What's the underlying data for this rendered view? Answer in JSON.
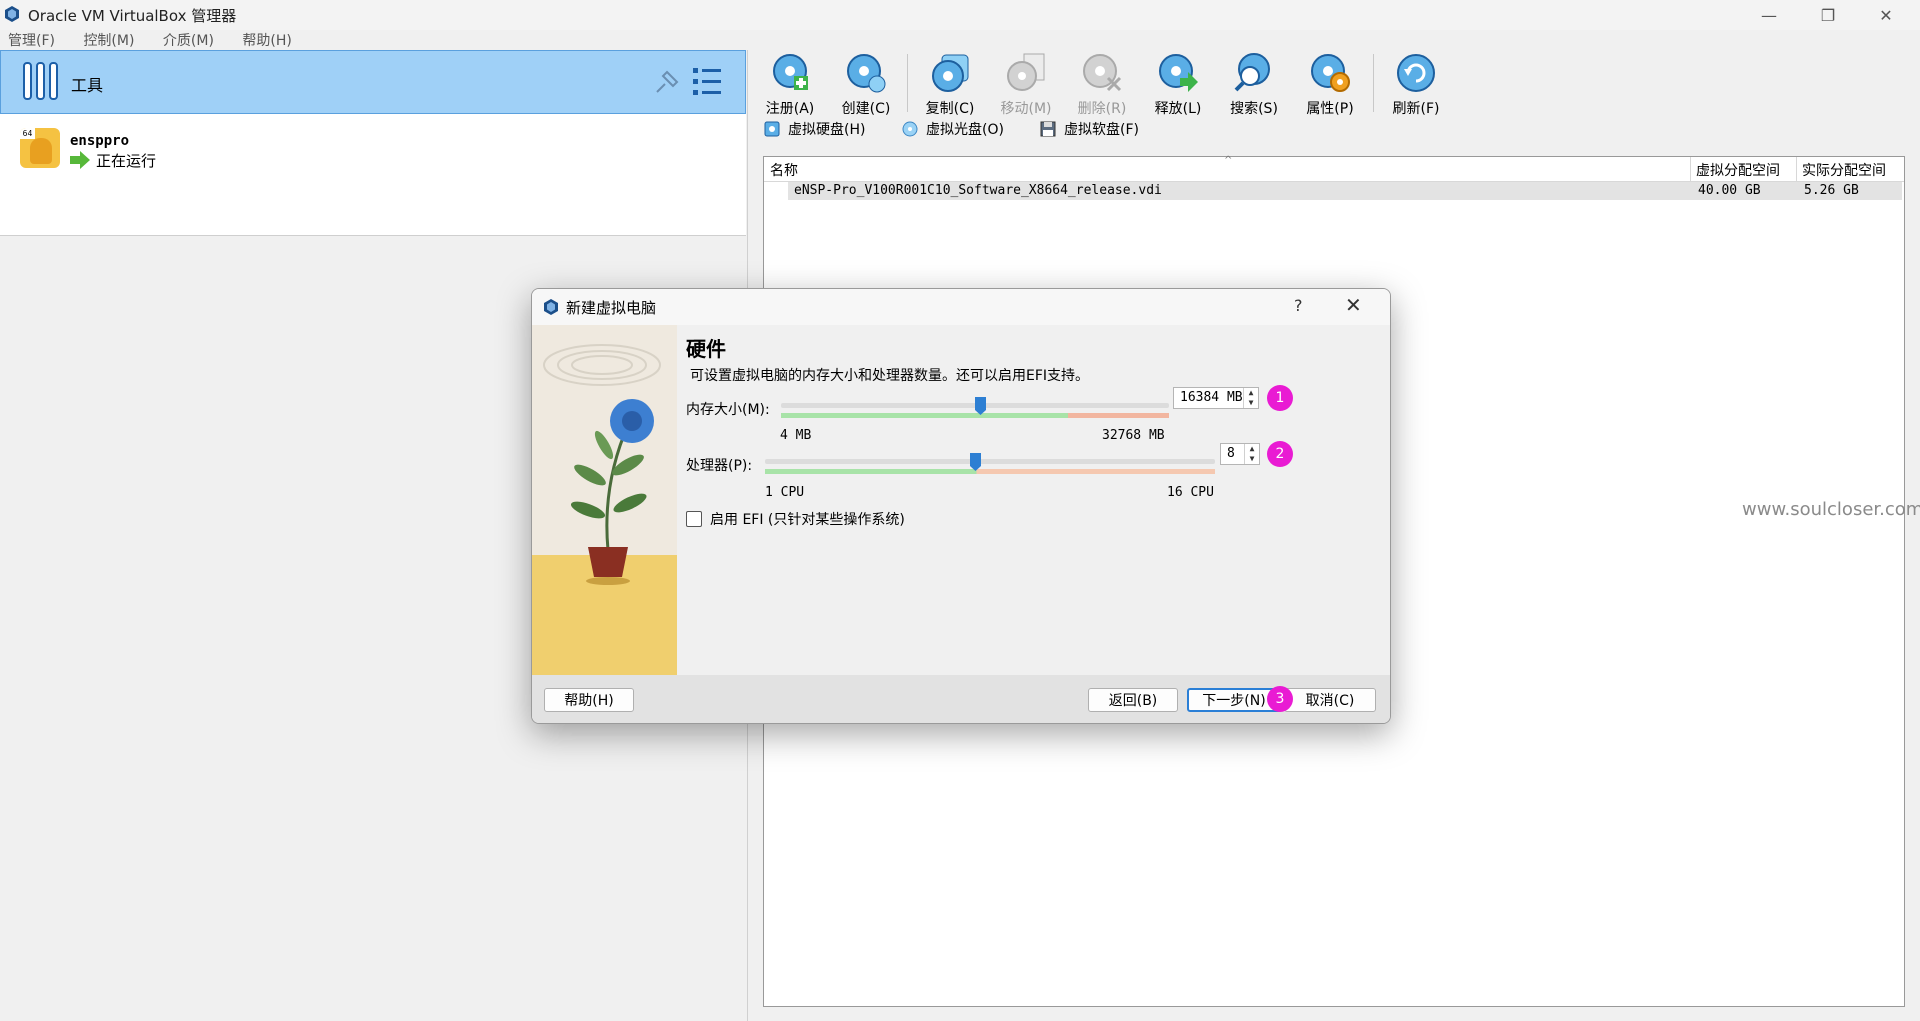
{
  "window": {
    "title": "Oracle VM VirtualBox 管理器",
    "controls": {
      "minimize": "—",
      "restore": "❐",
      "close": "✕"
    }
  },
  "menu": [
    "管理(F)",
    "控制(M)",
    "介质(M)",
    "帮助(H)"
  ],
  "left_panel": {
    "tools_label": "工具",
    "vm": {
      "name": "ensppro",
      "status": "正在运行",
      "badge": "64"
    }
  },
  "toolbar": {
    "buttons": [
      {
        "label": "注册(A)",
        "icon": "register-disk-icon",
        "enabled": true
      },
      {
        "label": "创建(C)",
        "icon": "create-disk-icon",
        "enabled": true
      },
      {
        "label": "复制(C)",
        "icon": "copy-disk-icon",
        "enabled": true
      },
      {
        "label": "移动(M)",
        "icon": "move-disk-icon",
        "enabled": false
      },
      {
        "label": "删除(R)",
        "icon": "delete-disk-icon",
        "enabled": false
      },
      {
        "label": "释放(L)",
        "icon": "release-disk-icon",
        "enabled": true
      },
      {
        "label": "搜索(S)",
        "icon": "search-disk-icon",
        "enabled": true
      },
      {
        "label": "属性(P)",
        "icon": "properties-disk-icon",
        "enabled": true
      },
      {
        "label": "刷新(F)",
        "icon": "refresh-icon",
        "enabled": true
      }
    ]
  },
  "tabs": [
    {
      "label": "虚拟硬盘(H)",
      "icon": "hard-disk-icon"
    },
    {
      "label": "虚拟光盘(O)",
      "icon": "optical-disk-icon"
    },
    {
      "label": "虚拟软盘(F)",
      "icon": "floppy-disk-icon"
    }
  ],
  "table": {
    "columns": [
      "名称",
      "虚拟分配空间",
      "实际分配空间"
    ],
    "rows": [
      {
        "name": "eNSP-Pro_V100R001C10_Software_X8664_release.vdi",
        "virtual": "40.00 GB",
        "actual": "5.26 GB"
      }
    ]
  },
  "watermark": "www.soulcloser.com",
  "dialog": {
    "title": "新建虚拟电脑",
    "help_icon": "?",
    "close_icon": "✕",
    "heading": "硬件",
    "description": "可设置虚拟电脑的内存大小和处理器数量。还可以启用EFI支持。",
    "memory": {
      "label": "内存大小(M):",
      "min_label": "4 MB",
      "max_label": "32768 MB",
      "value": "16384 MB",
      "min": 4,
      "max": 32768,
      "current": 16384,
      "badge": "1"
    },
    "cpu": {
      "label": "处理器(P):",
      "min_label": "1 CPU",
      "max_label": "16 CPU",
      "value": "8",
      "min": 1,
      "max": 16,
      "current": 8,
      "badge": "2"
    },
    "efi": {
      "label": "启用 EFI (只针对某些操作系统)",
      "checked": false
    },
    "buttons": {
      "help": "帮助(H)",
      "back": "返回(B)",
      "next": "下一步(N)",
      "cancel": "取消(C)",
      "next_badge": "3"
    }
  }
}
